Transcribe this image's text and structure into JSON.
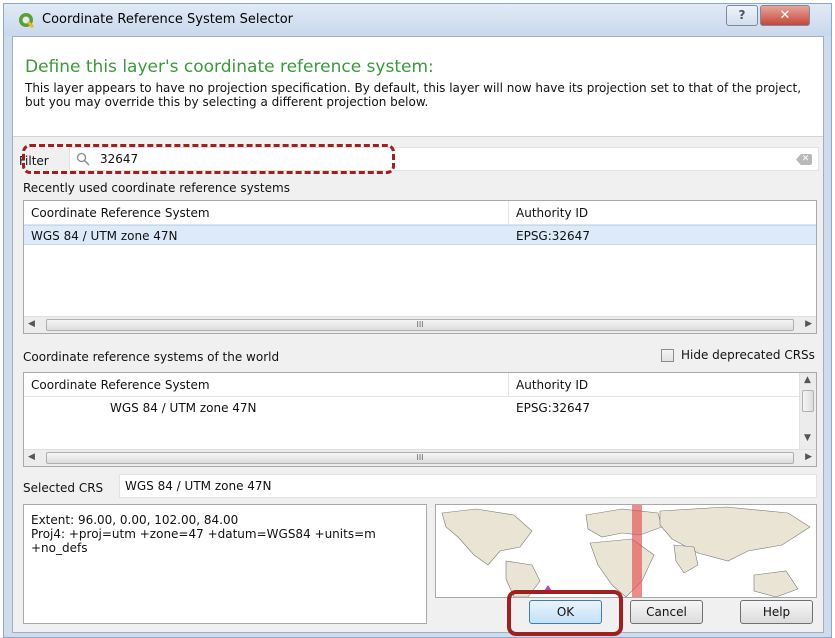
{
  "window": {
    "title": "Coordinate Reference System Selector",
    "help_glyph": "?",
    "close_glyph": "✕"
  },
  "header": {
    "title": "Define this layer's coordinate reference system:",
    "description": "This layer appears to have no projection specification. By default, this layer will now have its projection set to that of the project, but you may override this by selecting a different projection below."
  },
  "filter": {
    "label": "Filter",
    "value": "32647"
  },
  "recent": {
    "label": "Recently used coordinate reference systems",
    "columns": [
      "Coordinate Reference System",
      "Authority ID"
    ],
    "rows": [
      {
        "crs": "WGS 84 / UTM zone 47N",
        "authority": "EPSG:32647",
        "selected": true
      }
    ]
  },
  "world": {
    "label": "Coordinate reference systems of the world",
    "hide_deprecated_label": "Hide deprecated CRSs",
    "hide_deprecated_checked": false,
    "columns": [
      "Coordinate Reference System",
      "Authority ID"
    ],
    "rows": [
      {
        "crs": "WGS 84 / UTM zone 47N",
        "authority": "EPSG:32647"
      }
    ]
  },
  "selected_crs": {
    "label": "Selected CRS",
    "value": "WGS 84 / UTM zone 47N"
  },
  "details": {
    "extent": "Extent: 96.00, 0.00, 102.00, 84.00",
    "proj4_line1": "Proj4: +proj=utm +zone=47 +datum=WGS84 +units=m",
    "proj4_line2": "+no_defs"
  },
  "buttons": {
    "ok": "OK",
    "cancel": "Cancel",
    "help": "Help"
  },
  "scroll_glyph": "III",
  "colors": {
    "header_title": "#3a9a3a",
    "highlight": "#a02020",
    "selection": "#dceaf9",
    "map_zone": "#e05050"
  }
}
